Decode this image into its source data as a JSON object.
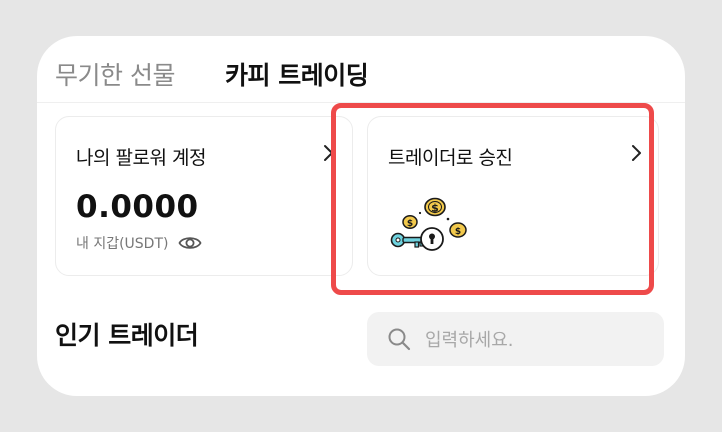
{
  "tabs": [
    {
      "label": "무기한 선물",
      "active": false
    },
    {
      "label": "카피 트레이딩",
      "active": true
    }
  ],
  "account_panel": {
    "title": "나의 팔로워 계정",
    "balance": "0.0000",
    "wallet_label": "내 지갑(USDT)",
    "chevron_icon": "chevron-right-icon",
    "visibility_icon": "eye-icon"
  },
  "trader_panel": {
    "title": "트레이더로 승진",
    "chevron_icon": "chevron-right-icon",
    "illustration": "coins-and-key-illustration"
  },
  "popular": {
    "title": "인기 트레이더"
  },
  "search": {
    "placeholder": "입력하세요.",
    "value": "",
    "icon": "search-icon"
  },
  "colors": {
    "highlight": "#ee4a4a",
    "coin": "#f2c94c",
    "key": "#6fd3df",
    "text_primary": "#111111",
    "text_muted": "#8a8a8a"
  }
}
